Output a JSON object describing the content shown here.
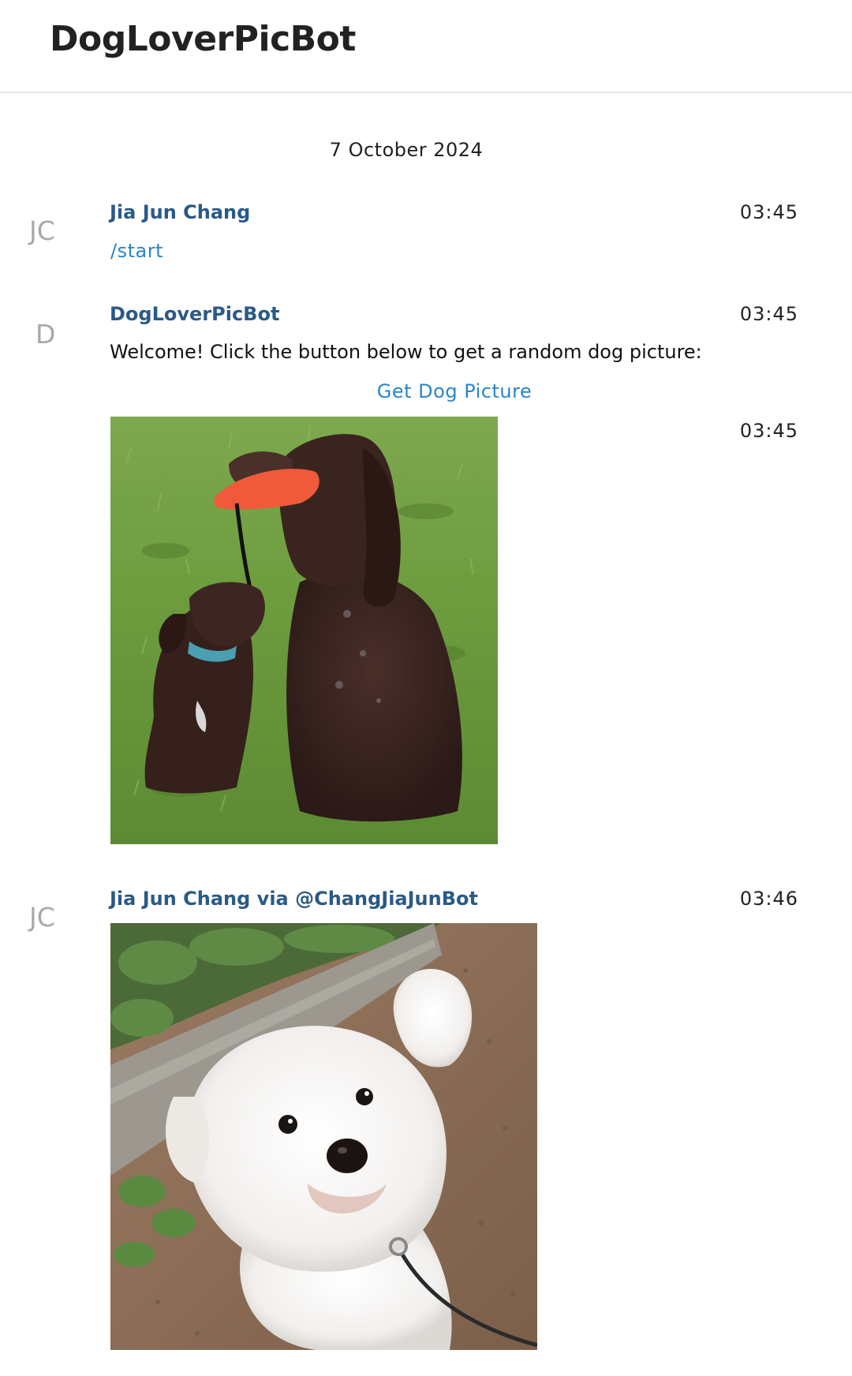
{
  "header": {
    "title": "DogLoverPicBot"
  },
  "chat": {
    "date": "7 October 2024",
    "messages": [
      {
        "avatar_initials": "JC",
        "sender": "Jia Jun Chang",
        "time": "03:45",
        "command": "/start"
      },
      {
        "avatar_initials": "D",
        "sender": "DogLoverPicBot",
        "time": "03:45",
        "text": "Welcome! Click the button below to get a random dog picture:",
        "button_label": "Get Dog Picture"
      },
      {
        "time": "03:45",
        "photo": "dog-photo-spaniels"
      },
      {
        "avatar_initials": "JC",
        "sender": "Jia Jun Chang via @ChangJiaJunBot",
        "time": "03:46",
        "photo": "dog-photo-bichon"
      }
    ]
  },
  "colors": {
    "sender_name": "#2a5a86",
    "link": "#2a85c8",
    "avatar_text": "#a8a8a8"
  }
}
